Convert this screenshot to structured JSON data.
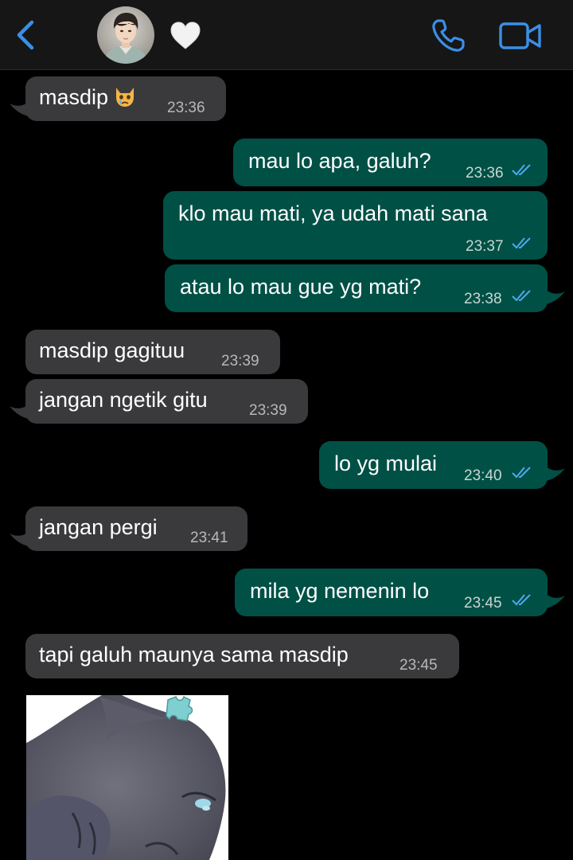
{
  "header": {
    "back_icon": "chevron-left-icon",
    "contact_status_emoji": "white-heart",
    "call_icon": "phone-icon",
    "video_icon": "video-camera-icon",
    "accent_color": "#3b8fe6"
  },
  "messages": [
    {
      "dir": "in",
      "text": "masdip",
      "emoji": "crying-cat-face",
      "time": "23:36"
    },
    {
      "dir": "out",
      "text": "mau lo apa, galuh?",
      "time": "23:36",
      "read": true
    },
    {
      "dir": "out",
      "text": "klo mau mati, ya udah mati sana",
      "time": "23:37",
      "read": true
    },
    {
      "dir": "out",
      "text": "atau lo mau gue yg mati?",
      "time": "23:38",
      "read": true
    },
    {
      "dir": "in",
      "text": "masdip gagituu",
      "time": "23:39"
    },
    {
      "dir": "in",
      "text": "jangan ngetik gitu",
      "time": "23:39"
    },
    {
      "dir": "out",
      "text": "lo yg mulai",
      "time": "23:40",
      "read": true
    },
    {
      "dir": "in",
      "text": "jangan pergi",
      "time": "23:41"
    },
    {
      "dir": "out",
      "text": "mila yg nemenin lo",
      "time": "23:45",
      "read": true
    },
    {
      "dir": "in",
      "text": "tapi galuh maunya sama masdip",
      "time": "23:45"
    }
  ],
  "sticker": {
    "description": "grey-cat-sticker",
    "dir": "in"
  },
  "colors": {
    "incoming_bubble": "#3a3a3c",
    "outgoing_bubble": "#005046",
    "read_ticks": "#4fa8ee",
    "background": "#000000"
  }
}
